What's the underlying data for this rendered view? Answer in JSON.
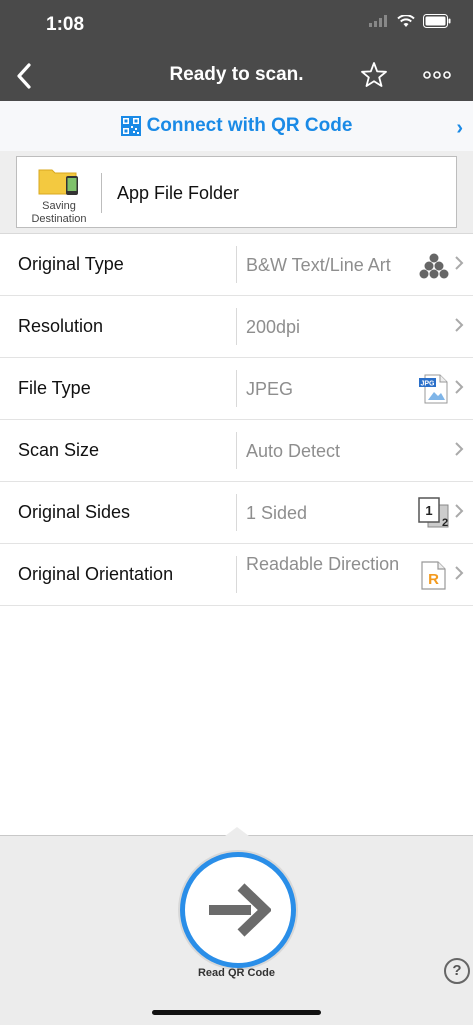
{
  "status_bar": {
    "time": "1:08"
  },
  "nav": {
    "title": "Ready to scan."
  },
  "qr_connect": {
    "label": "Connect with QR Code"
  },
  "destination": {
    "caption": "Saving Destination",
    "label": "App File Folder"
  },
  "settings": [
    {
      "label": "Original Type",
      "value": "B&W Text/Line Art",
      "icon": "color-dots-icon"
    },
    {
      "label": "Resolution",
      "value": "200dpi",
      "icon": ""
    },
    {
      "label": "File Type",
      "value": "JPEG",
      "icon": "jpg-file-icon",
      "icon_text": "JPG"
    },
    {
      "label": "Scan Size",
      "value": "Auto Detect",
      "icon": ""
    },
    {
      "label": "Original Sides",
      "value": "1 Sided",
      "icon": "sides-icon",
      "icon_text_1": "1",
      "icon_text_2": "2"
    },
    {
      "label": "Original Orientation",
      "value": "Readable Direction",
      "icon": "readable-direction-icon",
      "icon_text": "R"
    }
  ],
  "read_button": {
    "label": "Read QR Code"
  },
  "help": {
    "label": "?"
  },
  "colors": {
    "accent": "#2a8ee8",
    "link": "#1a8ae6",
    "header": "#4a4a4a"
  }
}
